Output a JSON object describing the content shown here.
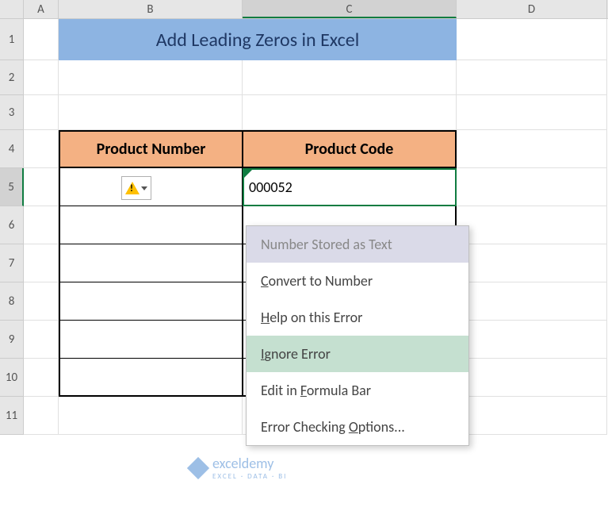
{
  "columns": {
    "A": "A",
    "B": "B",
    "C": "C",
    "D": "D"
  },
  "rows": {
    "r1": "1",
    "r2": "2",
    "r3": "3",
    "r4": "4",
    "r5": "5",
    "r6": "6",
    "r7": "7",
    "r8": "8",
    "r9": "9",
    "r10": "10",
    "r11": "11"
  },
  "title": "Add Leading Zeros in Excel",
  "table": {
    "headers": {
      "product_number": "Product Number",
      "product_code": "Product Code"
    },
    "data": {
      "c5": "000052"
    }
  },
  "menu": {
    "number_stored": "Number Stored as Text",
    "convert": "Convert to Number",
    "convert_u": "C",
    "help": "Help on this Error",
    "help_u": "H",
    "ignore": "Ignore Error",
    "ignore_u": "I",
    "edit": "Edit in Formula Bar",
    "edit_u": "F",
    "options": "Error Checking Options...",
    "options_u": "O"
  },
  "watermark": {
    "name": "exceldemy",
    "tagline": "EXCEL · DATA · BI"
  }
}
